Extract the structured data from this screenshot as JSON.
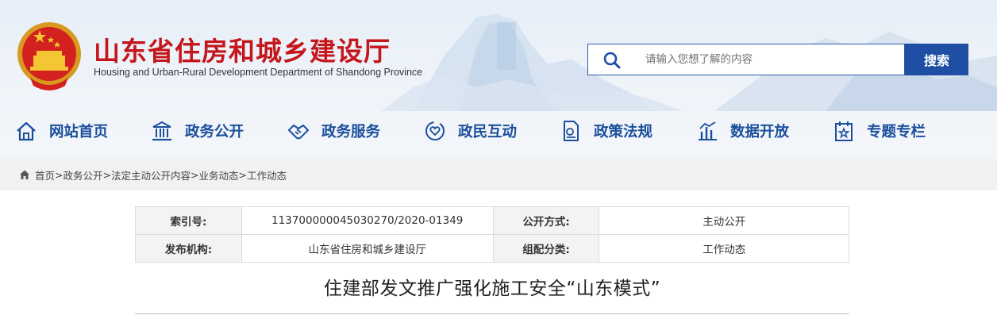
{
  "header": {
    "site_title": "山东省住房和城乡建设厅",
    "site_subtitle": "Housing and Urban-Rural Development Department of Shandong Province",
    "emblem_icon": "national-emblem-icon",
    "accent_color": "#c4161c",
    "brand_blue": "#1e4fa5"
  },
  "search": {
    "placeholder": "请输入您想了解的内容",
    "button_label": "搜索",
    "icon": "search-icon"
  },
  "nav": {
    "items": [
      {
        "label": "网站首页",
        "icon": "home-icon"
      },
      {
        "label": "政务公开",
        "icon": "government-building-icon"
      },
      {
        "label": "政务服务",
        "icon": "handshake-icon"
      },
      {
        "label": "政民互动",
        "icon": "heart-interaction-icon"
      },
      {
        "label": "政策法规",
        "icon": "document-icon"
      },
      {
        "label": "数据开放",
        "icon": "bar-chart-icon"
      },
      {
        "label": "专题专栏",
        "icon": "calendar-star-icon"
      }
    ]
  },
  "breadcrumb": {
    "items": [
      "首页",
      "政务公开",
      "法定主动公开内容",
      "业务动态",
      "工作动态"
    ],
    "separator": ">"
  },
  "meta_table": {
    "index_label": "索引号:",
    "index_value": "113700000045030270/2020-01349",
    "disclosure_label": "公开方式:",
    "disclosure_value": "主动公开",
    "publisher_label": "发布机构:",
    "publisher_value": "山东省住房和城乡建设厅",
    "category_label": "组配分类:",
    "category_value": "工作动态"
  },
  "article": {
    "title": "住建部发文推广强化施工安全“山东模式”"
  }
}
